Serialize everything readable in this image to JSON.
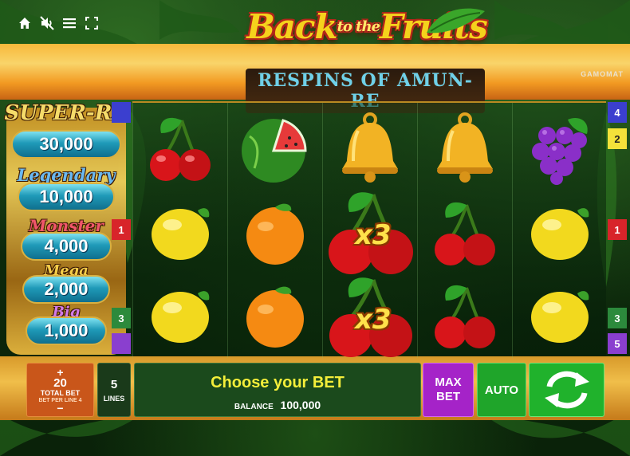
{
  "controls": {
    "home_icon": "home-icon",
    "sound_icon": "sound-muted-icon",
    "menu_icon": "menu-icon",
    "fullscreen_icon": "fullscreen-icon"
  },
  "logo": {
    "title_main": "Back",
    "title_small": "to the",
    "title_end": "Fruits",
    "subtitle": "RESPINS OF AMUN-RE",
    "brand": "GAMOMAT"
  },
  "jackpots": [
    {
      "name": "SUPER-RA",
      "value": "30,000",
      "color": "#f3c94a"
    },
    {
      "name": "Legendary",
      "value": "10,000",
      "color": "#4aa3e8"
    },
    {
      "name": "Monster",
      "value": "4,000",
      "color": "#e83a4a"
    },
    {
      "name": "Mega",
      "value": "2,000",
      "color": "#f0c440"
    },
    {
      "name": "Big",
      "value": "1,000",
      "color": "#c25ad8"
    }
  ],
  "reels": [
    [
      "cherry",
      "lemon",
      "lemon"
    ],
    [
      "watermelon",
      "orange",
      "orange"
    ],
    [
      "bell",
      "cherry-multiplier",
      "cherry-multiplier"
    ],
    [
      "bell",
      "cherry",
      "cherry"
    ],
    [
      "grapes",
      "lemon",
      "lemon"
    ]
  ],
  "multipliers": [
    "x3",
    "x3"
  ],
  "line_markers": {
    "left": [
      {
        "label": "1",
        "color": "#d8242a"
      },
      {
        "label": "3",
        "color": "#2c8a3c"
      }
    ],
    "right": [
      {
        "label": "4",
        "color": "#3b3fcf"
      },
      {
        "label": "2",
        "color": "#f4e23a"
      },
      {
        "label": "1",
        "color": "#d8242a"
      },
      {
        "label": "3",
        "color": "#2c8a3c"
      },
      {
        "label": "5",
        "color": "#8a3fcf"
      }
    ]
  },
  "bottom_bar": {
    "bet_plus": "+",
    "bet_value": "20",
    "bet_label": "TOTAL BET",
    "bet_per_line_label": "BET PER LINE",
    "bet_per_line_value": "4",
    "bet_minus": "−",
    "lines_value": "5",
    "lines_label": "LINES",
    "message": "Choose your BET",
    "balance_label": "BALANCE",
    "balance_value": "100,000",
    "max_bet_label": "MAX BET",
    "auto_label": "AUTO",
    "spin_icon": "spin-arrows-icon"
  }
}
